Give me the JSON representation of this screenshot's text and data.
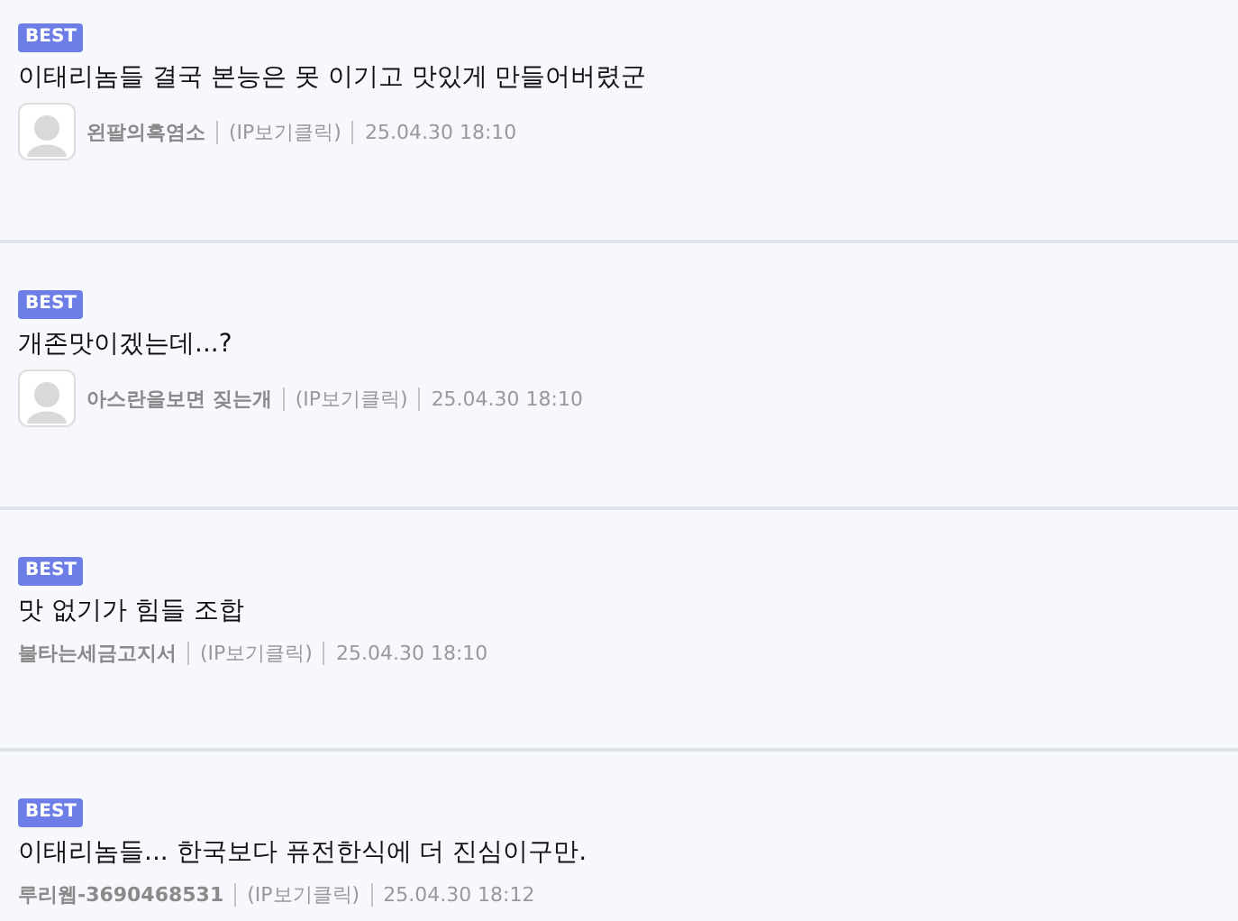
{
  "comments": [
    {
      "badge": "BEST",
      "text": "이태리놈들 결국 본능은 못 이기고 맛있게 만들어버렸군",
      "avatar": true,
      "author": "왼팔의흑염소",
      "ip": "(IP보기클릭)",
      "date": "25.04.30 18:10"
    },
    {
      "badge": "BEST",
      "text": "개존맛이겠는데...?",
      "avatar": true,
      "author": "아스란을보면 짖는개",
      "ip": "(IP보기클릭)",
      "date": "25.04.30 18:10"
    },
    {
      "badge": "BEST",
      "text": "맛 없기가 힘들 조합",
      "avatar": false,
      "author": "불타는세금고지서",
      "ip": "(IP보기클릭)",
      "date": "25.04.30 18:10"
    },
    {
      "badge": "BEST",
      "text": "이태리놈들... 한국보다 퓨전한식에 더 진심이구만.",
      "avatar": false,
      "author": "루리웹-3690468531",
      "ip": "(IP보기클릭)",
      "date": "25.04.30 18:12"
    }
  ]
}
